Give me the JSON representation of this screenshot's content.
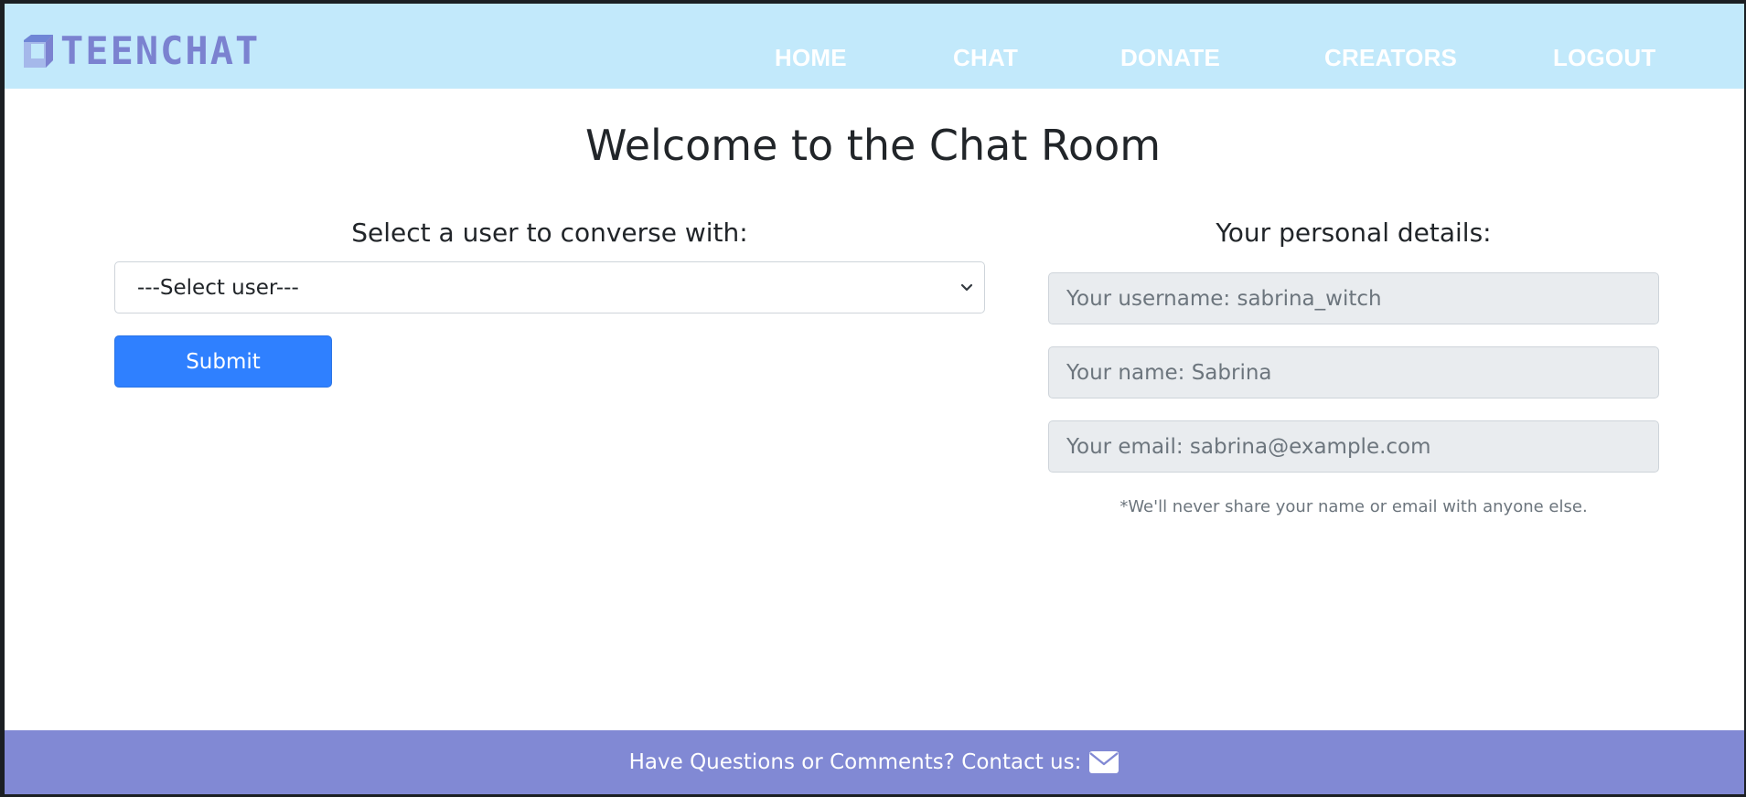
{
  "brand": {
    "name": "TEENCHAT",
    "logo_color": "#7b82d0"
  },
  "nav": {
    "items": [
      {
        "label": "HOME"
      },
      {
        "label": "CHAT"
      },
      {
        "label": "DONATE"
      },
      {
        "label": "CREATORS"
      },
      {
        "label": "LOGOUT"
      }
    ]
  },
  "main": {
    "title": "Welcome to the Chat Room",
    "select_section": {
      "heading": "Select a user to converse with:",
      "select_value": "---Select user---",
      "submit_label": "Submit"
    },
    "details_section": {
      "heading": "Your personal details:",
      "username_placeholder": "Your username: sabrina_witch",
      "name_placeholder": "Your name: Sabrina",
      "email_placeholder": "Your email: sabrina@example.com",
      "help_text": "*We'll never share your name or email with anyone else."
    }
  },
  "footer": {
    "text": "Have Questions or Comments? Contact us:",
    "icon": "envelope-icon"
  },
  "colors": {
    "navbar_bg": "#c2e9fb",
    "footer_bg": "#8189d4",
    "primary_button": "#2f80ff",
    "disabled_field_bg": "#e9ecef"
  }
}
